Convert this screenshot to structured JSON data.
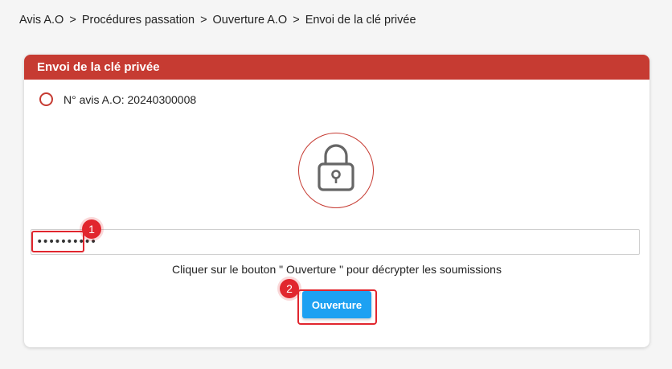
{
  "breadcrumb": {
    "items": [
      "Avis A.O",
      "Procédures passation",
      "Ouverture A.O",
      "Envoi de la clé privée"
    ],
    "separator": ">"
  },
  "card": {
    "title": "Envoi de la clé privée",
    "radio_label": "N° avis A.O: 20240300008",
    "icon": "lock-icon",
    "key_input": {
      "value": "••••••••••"
    },
    "hint": "Cliquer sur le bouton \" Ouverture \" pour décrypter les soumissions",
    "button_label": "Ouverture"
  },
  "annotations": {
    "badge_1": "1",
    "badge_2": "2"
  },
  "colors": {
    "header": "#c63b32",
    "accent_button": "#1da1f2",
    "annotation": "#e1262e"
  }
}
